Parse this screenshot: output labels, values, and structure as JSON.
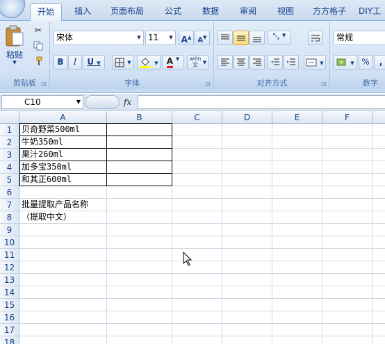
{
  "tabs": [
    "开始",
    "插入",
    "页面布局",
    "公式",
    "数据",
    "审阅",
    "视图",
    "方方格子",
    "DIY工"
  ],
  "active_tab": "开始",
  "clipboard": {
    "paste_label": "粘贴",
    "group_label": "剪贴板"
  },
  "font": {
    "name": "宋体",
    "size": "11",
    "group_label": "字体",
    "bold": "B",
    "italic": "I",
    "underline": "U",
    "grow": "A",
    "shrink": "A",
    "font_color": "A",
    "wen": "wén\n文"
  },
  "alignment": {
    "group_label": "对齐方式"
  },
  "number": {
    "format": "常规",
    "percent": "%",
    "comma": ",",
    "group_label": "数字"
  },
  "name_box": "C10",
  "fx_label": "fx",
  "columns": [
    "A",
    "B",
    "C",
    "D",
    "E",
    "F"
  ],
  "rows": [
    "1",
    "2",
    "3",
    "4",
    "5",
    "6",
    "7",
    "8",
    "9",
    "10",
    "11",
    "12",
    "13",
    "14",
    "15",
    "16",
    "17",
    "18"
  ],
  "cells": {
    "A1": "贝奇野菜500ml",
    "A2": "牛奶350ml",
    "A3": "果汁260ml",
    "A4": "加多宝350ml",
    "A5": "和其正600ml",
    "A7": "批量提取产品名称",
    "A8": "（提取中文）"
  },
  "colors": {
    "ribbon": "#dbe7f6",
    "accent": "#15428b",
    "highlight": "#ffd978"
  }
}
